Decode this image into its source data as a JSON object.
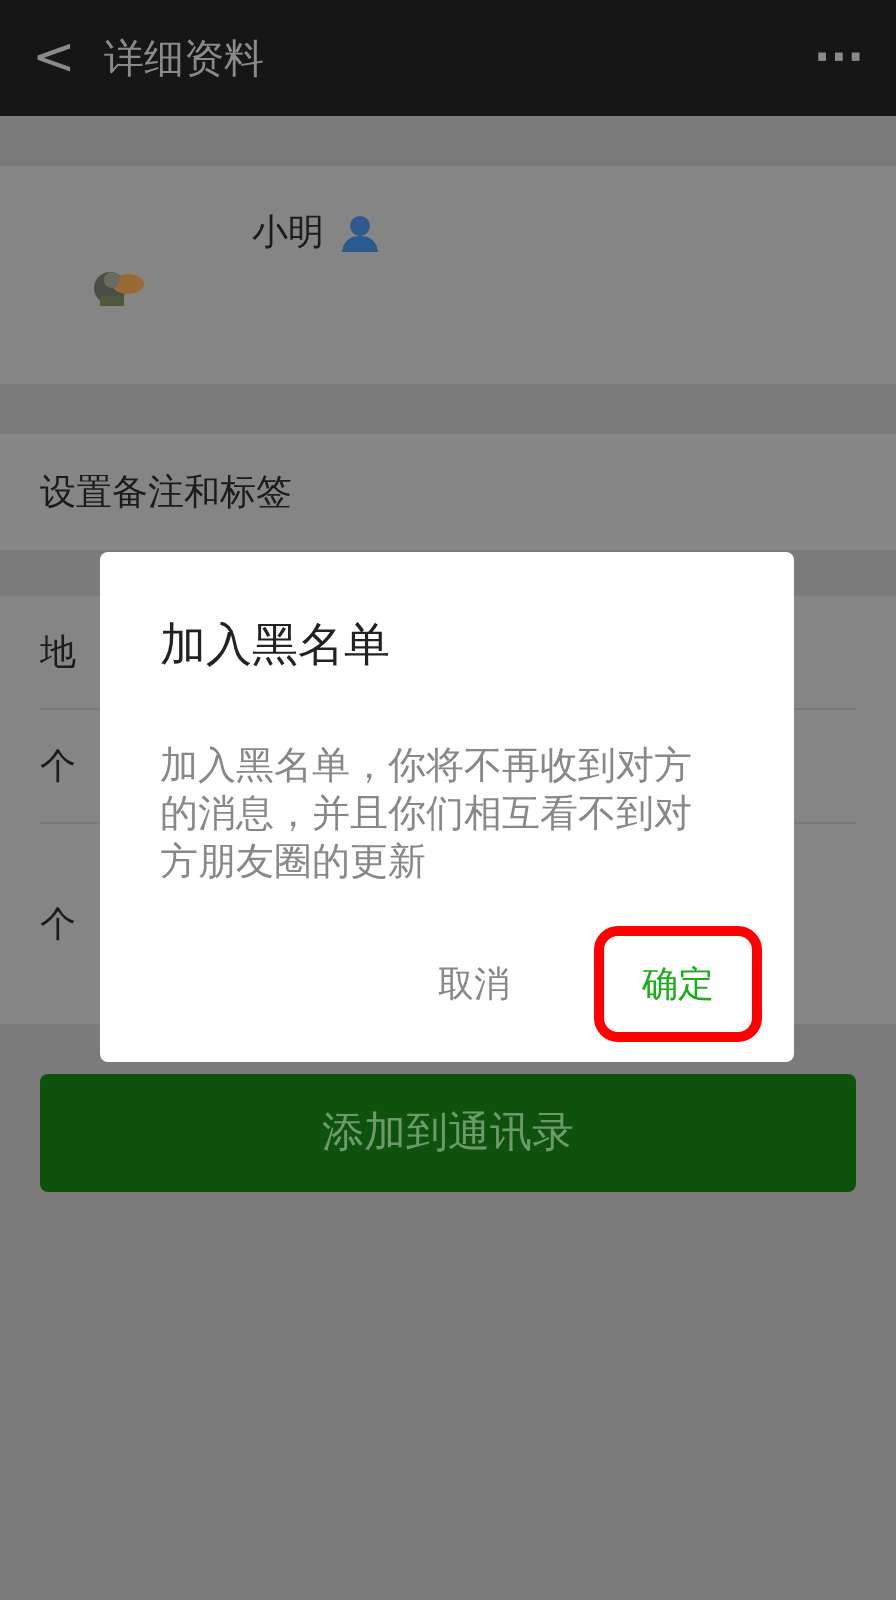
{
  "header": {
    "back_icon": "<",
    "title": "详细资料",
    "more": "···"
  },
  "profile": {
    "name": "小明"
  },
  "rows": [
    {
      "label": "设置备注和标签"
    }
  ],
  "info_rows": [
    {
      "label": "地"
    },
    {
      "label": "个"
    },
    {
      "label": "个"
    }
  ],
  "add_button": "添加到通讯录",
  "dialog": {
    "title": "加入黑名单",
    "message": "加入黑名单，你将不再收到对方的消息，并且你们相互看不到对方朋友圈的更新",
    "buttons": [
      {
        "label": "取消",
        "kind": "cancel",
        "highlighted": false
      },
      {
        "label": "确定",
        "kind": "confirm",
        "highlighted": true
      }
    ]
  }
}
